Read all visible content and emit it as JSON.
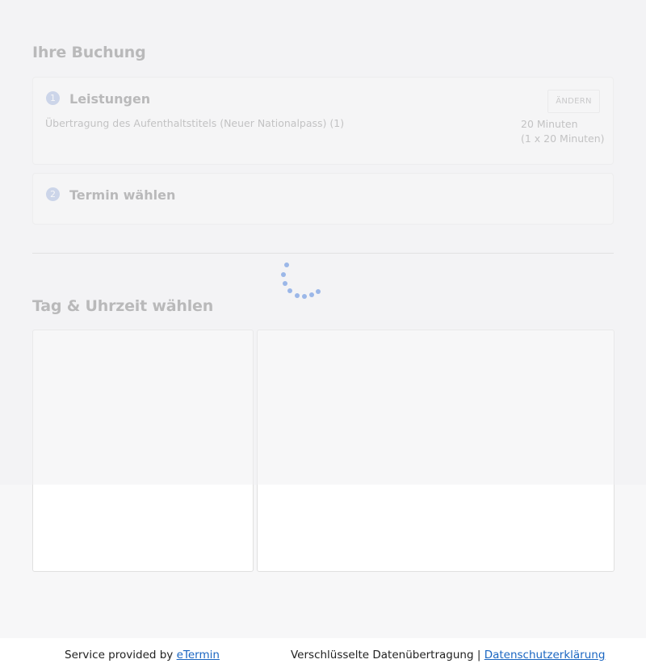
{
  "booking": {
    "heading": "Ihre Buchung",
    "step1": {
      "number": "1",
      "title": "Leistungen",
      "change_label": "ÄNDERN",
      "service": "Übertragung des Aufenthaltstitels (Neuer Nationalpass) (1)",
      "duration_total": "20 Minuten",
      "duration_detail": "(1 x 20 Minuten)"
    },
    "step2": {
      "number": "2",
      "title": "Termin wählen"
    }
  },
  "slot_section": {
    "heading": "Tag & Uhrzeit wählen"
  },
  "footer": {
    "provided_prefix": "Service provided by ",
    "provider_link": "eTermin",
    "encryption_text": "Verschlüsselte Datenübertragung | ",
    "privacy_link": "Datenschutzerklärung"
  },
  "colors": {
    "accent": "#9fb3dd",
    "spinner": "#9bb7e8",
    "link": "#1a66c2"
  }
}
